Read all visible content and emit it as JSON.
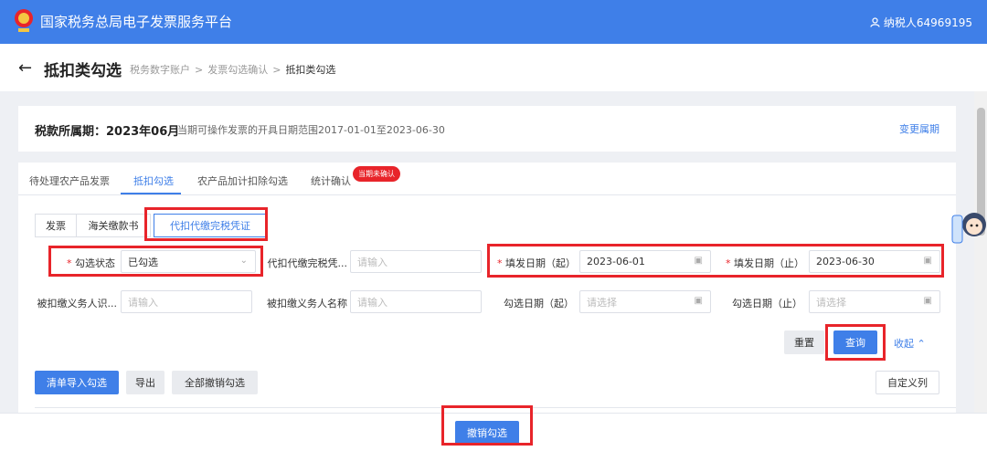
{
  "header": {
    "app_title": "国家税务总局电子发票服务平台",
    "user": "纳税人64969195"
  },
  "page": {
    "title": "抵扣类勾选",
    "breadcrumb": [
      "税务数字账户",
      "发票勾选确认",
      "抵扣类勾选"
    ]
  },
  "period": {
    "label": "税款所属期：2023年06月",
    "note": "当期可操作发票的开具日期范围2017-01-01至2023-06-30",
    "change_link": "变更属期"
  },
  "tabs": [
    {
      "label": "待处理农产品发票"
    },
    {
      "label": "抵扣勾选"
    },
    {
      "label": "农产品加计扣除勾选"
    },
    {
      "label": "统计确认"
    }
  ],
  "tab_badge": "当期未确认",
  "subtabs": [
    {
      "label": "发票"
    },
    {
      "label": "海关缴款书"
    },
    {
      "label": "代扣代缴完税凭证"
    }
  ],
  "filters": {
    "check_status": {
      "label": "勾选状态",
      "value": "已勾选"
    },
    "voucher_no": {
      "label": "代扣代缴完税凭...",
      "placeholder": "请输入"
    },
    "fill_date_start": {
      "label": "填发日期（起）",
      "value": "2023-06-01"
    },
    "fill_date_end": {
      "label": "填发日期（止）",
      "value": "2023-06-30"
    },
    "withholder_id": {
      "label": "被扣缴义务人识...",
      "placeholder": "请输入"
    },
    "withholder_name": {
      "label": "被扣缴义务人名称",
      "placeholder": "请输入"
    },
    "check_date_start": {
      "label": "勾选日期（起）",
      "placeholder": "请选择"
    },
    "check_date_end": {
      "label": "勾选日期（止）",
      "placeholder": "请选择"
    }
  },
  "actions": {
    "reset": "重置",
    "query": "查询",
    "collapse": "收起",
    "import": "清单导入勾选",
    "export": "导出",
    "cancel_all": "全部撤销勾选",
    "custom_columns": "自定义列",
    "cancel_check": "撤销勾选"
  },
  "icons": {
    "logo": "tax-emblem-icon",
    "user": "user-icon",
    "back": "arrow-left-icon",
    "select": "chevron-down-icon",
    "date": "calendar-icon",
    "collapse": "chevron-up-icon",
    "assistant": "mascot-assistant-icon"
  },
  "colors": {
    "primary": "#3f7fe8",
    "highlight": "#e8242a",
    "badge": "#e8242a"
  }
}
